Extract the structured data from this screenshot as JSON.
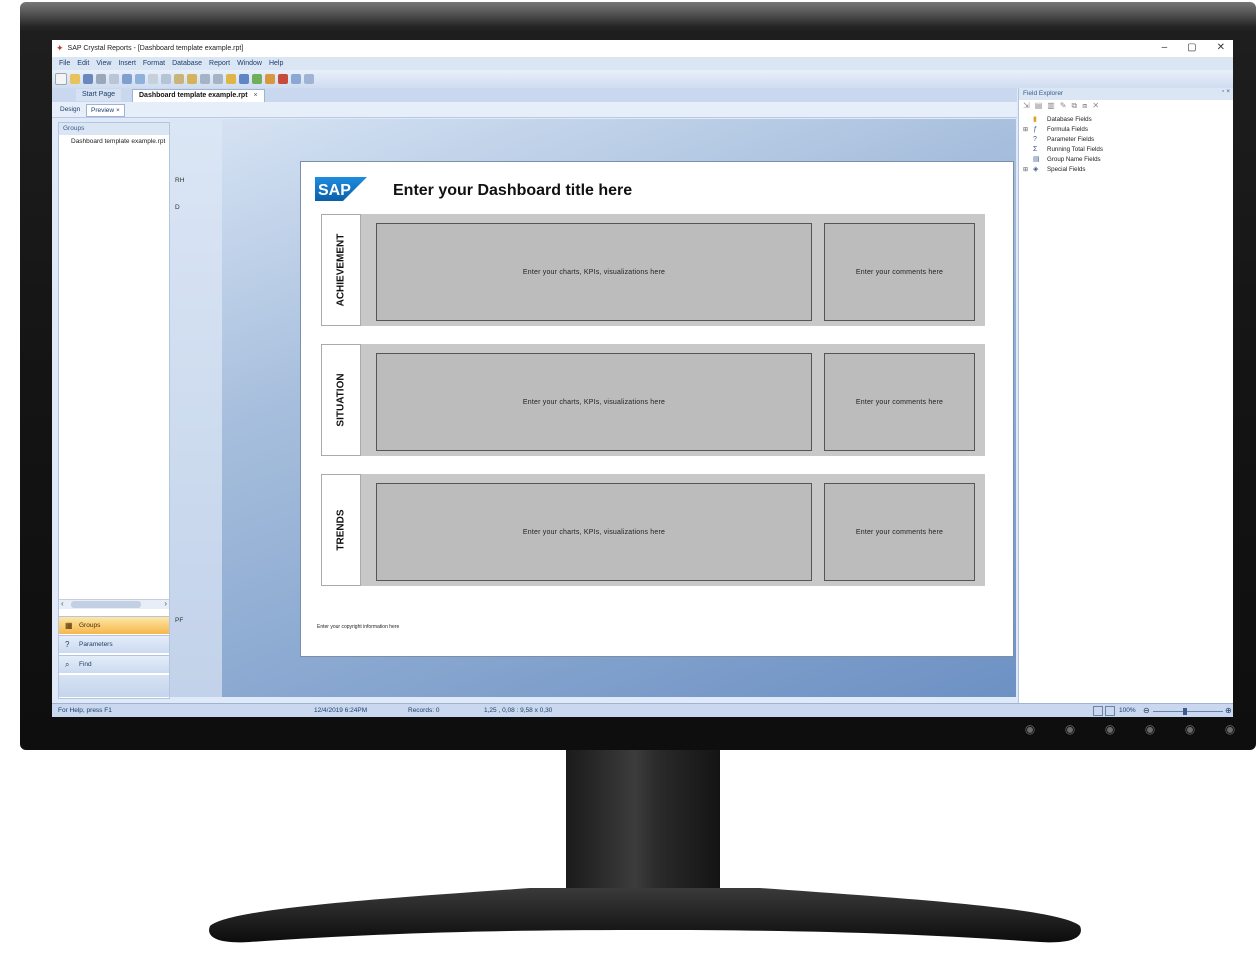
{
  "window": {
    "title": "SAP Crystal Reports - [Dashboard template example.rpt]",
    "controls": [
      "–",
      "▢",
      "✕"
    ]
  },
  "menu": [
    "File",
    "Edit",
    "View",
    "Insert",
    "Format",
    "Database",
    "Report",
    "Window",
    "Help"
  ],
  "doc_tabs": {
    "start": "Start Page",
    "active": "Dashboard template example.rpt",
    "close": "×"
  },
  "view_tabs": {
    "design": "Design",
    "preview": "Preview",
    "close": "×"
  },
  "left_panel": {
    "header": "Groups",
    "tree_item": "Dashboard template example.rpt",
    "nav": {
      "groups": "Groups",
      "parameters": "Parameters",
      "find": "Find"
    }
  },
  "section_rail": {
    "rh": "RH",
    "d": "D",
    "pf": "PF"
  },
  "report": {
    "logo": "SAP",
    "title": "Enter your Dashboard title here",
    "sections": [
      {
        "label": "ACHIEVEMENT",
        "chart_text": "Enter your charts, KPIs, visualizations here",
        "comment_text": "Enter your comments here"
      },
      {
        "label": "SITUATION",
        "chart_text": "Enter your charts, KPIs, visualizations here",
        "comment_text": "Enter your comments here"
      },
      {
        "label": "TRENDS",
        "chart_text": "Enter your charts, KPIs, visualizations here",
        "comment_text": "Enter your comments here"
      }
    ],
    "copyright": "Enter your copyright information here"
  },
  "field_explorer": {
    "header": "Field Explorer",
    "header_controls": "▫ ×",
    "items": [
      {
        "label": "Database Fields",
        "expander": "",
        "icon": "database-icon"
      },
      {
        "label": "Formula Fields",
        "expander": "⊞",
        "icon": "formula-icon"
      },
      {
        "label": "Parameter Fields",
        "expander": "",
        "icon": "parameter-icon"
      },
      {
        "label": "Running Total Fields",
        "expander": "",
        "icon": "running-total-icon"
      },
      {
        "label": "Group Name Fields",
        "expander": "",
        "icon": "group-name-icon"
      },
      {
        "label": "Special Fields",
        "expander": "⊞",
        "icon": "special-fields-icon"
      }
    ]
  },
  "status": {
    "help": "For Help, press F1",
    "datetime": "12/4/2019  6:24PM",
    "records": "Records: 0",
    "position": "1,25 , 0,08 : 9,58 x 0,30",
    "zoom": "100%"
  },
  "colors": {
    "accent_orange": "#f7b64b",
    "sap_blue": "#1673c7",
    "panel_blue": "#dbe6f5",
    "canvas_blue": "#6d91c4"
  }
}
